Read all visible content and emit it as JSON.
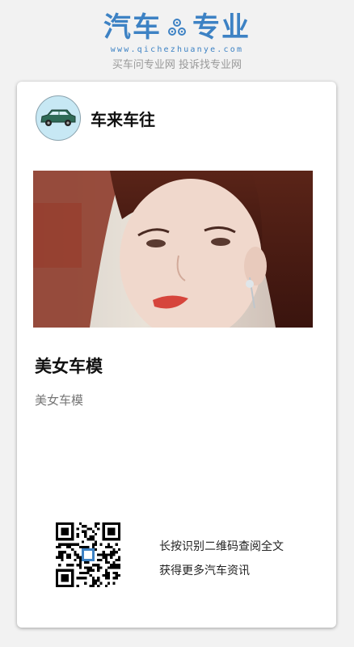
{
  "brand": {
    "logo_left": "汽车",
    "logo_right": "专业",
    "domain": "www.qichezhuanye.com",
    "slogan": "买车问专业网 投诉找专业网",
    "accent_color": "#3d82c4"
  },
  "author": {
    "name": "车来车往",
    "avatar_icon": "green-car-icon"
  },
  "article": {
    "image_icon": "car-model-photo",
    "title": "美女车模",
    "description": "美女车模"
  },
  "qr": {
    "icon": "qr-code-icon",
    "line1": "长按识别二维码查阅全文",
    "line2": "获得更多汽车资讯"
  }
}
